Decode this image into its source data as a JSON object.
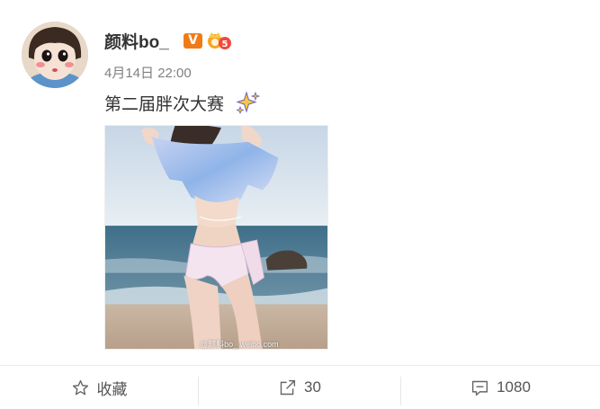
{
  "post": {
    "username": "颜料bo_",
    "verified_badge": "V",
    "timestamp": "4月14日 22:00",
    "text": "第二届胖次大赛",
    "text_emoji": "sparkles-icon",
    "image_watermark": "@颜料bo_  weibo.com"
  },
  "actions": {
    "favorite_label": "收藏",
    "repost_count": "30",
    "comment_count": "1080"
  },
  "colors": {
    "badge_orange": "#f07b16",
    "text_primary": "#333333",
    "text_secondary": "#808080",
    "icon_gray": "#666666"
  }
}
